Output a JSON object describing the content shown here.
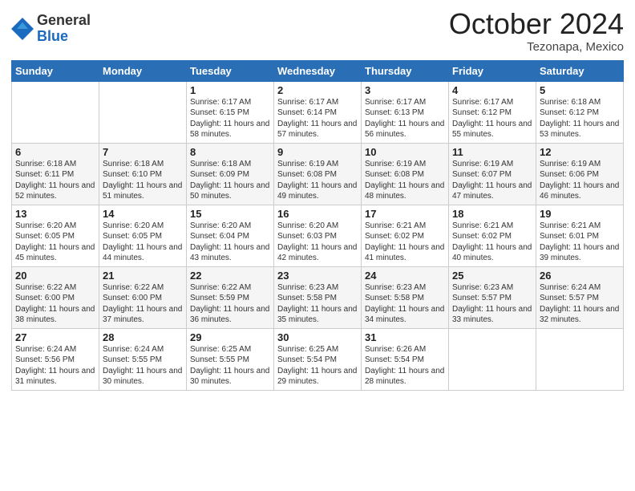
{
  "header": {
    "logo_general": "General",
    "logo_blue": "Blue",
    "month_title": "October 2024",
    "subtitle": "Tezonapa, Mexico"
  },
  "weekdays": [
    "Sunday",
    "Monday",
    "Tuesday",
    "Wednesday",
    "Thursday",
    "Friday",
    "Saturday"
  ],
  "weeks": [
    [
      {
        "day": "",
        "sunrise": "",
        "sunset": "",
        "daylight": ""
      },
      {
        "day": "",
        "sunrise": "",
        "sunset": "",
        "daylight": ""
      },
      {
        "day": "1",
        "sunrise": "Sunrise: 6:17 AM",
        "sunset": "Sunset: 6:15 PM",
        "daylight": "Daylight: 11 hours and 58 minutes."
      },
      {
        "day": "2",
        "sunrise": "Sunrise: 6:17 AM",
        "sunset": "Sunset: 6:14 PM",
        "daylight": "Daylight: 11 hours and 57 minutes."
      },
      {
        "day": "3",
        "sunrise": "Sunrise: 6:17 AM",
        "sunset": "Sunset: 6:13 PM",
        "daylight": "Daylight: 11 hours and 56 minutes."
      },
      {
        "day": "4",
        "sunrise": "Sunrise: 6:17 AM",
        "sunset": "Sunset: 6:12 PM",
        "daylight": "Daylight: 11 hours and 55 minutes."
      },
      {
        "day": "5",
        "sunrise": "Sunrise: 6:18 AM",
        "sunset": "Sunset: 6:12 PM",
        "daylight": "Daylight: 11 hours and 53 minutes."
      }
    ],
    [
      {
        "day": "6",
        "sunrise": "Sunrise: 6:18 AM",
        "sunset": "Sunset: 6:11 PM",
        "daylight": "Daylight: 11 hours and 52 minutes."
      },
      {
        "day": "7",
        "sunrise": "Sunrise: 6:18 AM",
        "sunset": "Sunset: 6:10 PM",
        "daylight": "Daylight: 11 hours and 51 minutes."
      },
      {
        "day": "8",
        "sunrise": "Sunrise: 6:18 AM",
        "sunset": "Sunset: 6:09 PM",
        "daylight": "Daylight: 11 hours and 50 minutes."
      },
      {
        "day": "9",
        "sunrise": "Sunrise: 6:19 AM",
        "sunset": "Sunset: 6:08 PM",
        "daylight": "Daylight: 11 hours and 49 minutes."
      },
      {
        "day": "10",
        "sunrise": "Sunrise: 6:19 AM",
        "sunset": "Sunset: 6:08 PM",
        "daylight": "Daylight: 11 hours and 48 minutes."
      },
      {
        "day": "11",
        "sunrise": "Sunrise: 6:19 AM",
        "sunset": "Sunset: 6:07 PM",
        "daylight": "Daylight: 11 hours and 47 minutes."
      },
      {
        "day": "12",
        "sunrise": "Sunrise: 6:19 AM",
        "sunset": "Sunset: 6:06 PM",
        "daylight": "Daylight: 11 hours and 46 minutes."
      }
    ],
    [
      {
        "day": "13",
        "sunrise": "Sunrise: 6:20 AM",
        "sunset": "Sunset: 6:05 PM",
        "daylight": "Daylight: 11 hours and 45 minutes."
      },
      {
        "day": "14",
        "sunrise": "Sunrise: 6:20 AM",
        "sunset": "Sunset: 6:05 PM",
        "daylight": "Daylight: 11 hours and 44 minutes."
      },
      {
        "day": "15",
        "sunrise": "Sunrise: 6:20 AM",
        "sunset": "Sunset: 6:04 PM",
        "daylight": "Daylight: 11 hours and 43 minutes."
      },
      {
        "day": "16",
        "sunrise": "Sunrise: 6:20 AM",
        "sunset": "Sunset: 6:03 PM",
        "daylight": "Daylight: 11 hours and 42 minutes."
      },
      {
        "day": "17",
        "sunrise": "Sunrise: 6:21 AM",
        "sunset": "Sunset: 6:02 PM",
        "daylight": "Daylight: 11 hours and 41 minutes."
      },
      {
        "day": "18",
        "sunrise": "Sunrise: 6:21 AM",
        "sunset": "Sunset: 6:02 PM",
        "daylight": "Daylight: 11 hours and 40 minutes."
      },
      {
        "day": "19",
        "sunrise": "Sunrise: 6:21 AM",
        "sunset": "Sunset: 6:01 PM",
        "daylight": "Daylight: 11 hours and 39 minutes."
      }
    ],
    [
      {
        "day": "20",
        "sunrise": "Sunrise: 6:22 AM",
        "sunset": "Sunset: 6:00 PM",
        "daylight": "Daylight: 11 hours and 38 minutes."
      },
      {
        "day": "21",
        "sunrise": "Sunrise: 6:22 AM",
        "sunset": "Sunset: 6:00 PM",
        "daylight": "Daylight: 11 hours and 37 minutes."
      },
      {
        "day": "22",
        "sunrise": "Sunrise: 6:22 AM",
        "sunset": "Sunset: 5:59 PM",
        "daylight": "Daylight: 11 hours and 36 minutes."
      },
      {
        "day": "23",
        "sunrise": "Sunrise: 6:23 AM",
        "sunset": "Sunset: 5:58 PM",
        "daylight": "Daylight: 11 hours and 35 minutes."
      },
      {
        "day": "24",
        "sunrise": "Sunrise: 6:23 AM",
        "sunset": "Sunset: 5:58 PM",
        "daylight": "Daylight: 11 hours and 34 minutes."
      },
      {
        "day": "25",
        "sunrise": "Sunrise: 6:23 AM",
        "sunset": "Sunset: 5:57 PM",
        "daylight": "Daylight: 11 hours and 33 minutes."
      },
      {
        "day": "26",
        "sunrise": "Sunrise: 6:24 AM",
        "sunset": "Sunset: 5:57 PM",
        "daylight": "Daylight: 11 hours and 32 minutes."
      }
    ],
    [
      {
        "day": "27",
        "sunrise": "Sunrise: 6:24 AM",
        "sunset": "Sunset: 5:56 PM",
        "daylight": "Daylight: 11 hours and 31 minutes."
      },
      {
        "day": "28",
        "sunrise": "Sunrise: 6:24 AM",
        "sunset": "Sunset: 5:55 PM",
        "daylight": "Daylight: 11 hours and 30 minutes."
      },
      {
        "day": "29",
        "sunrise": "Sunrise: 6:25 AM",
        "sunset": "Sunset: 5:55 PM",
        "daylight": "Daylight: 11 hours and 30 minutes."
      },
      {
        "day": "30",
        "sunrise": "Sunrise: 6:25 AM",
        "sunset": "Sunset: 5:54 PM",
        "daylight": "Daylight: 11 hours and 29 minutes."
      },
      {
        "day": "31",
        "sunrise": "Sunrise: 6:26 AM",
        "sunset": "Sunset: 5:54 PM",
        "daylight": "Daylight: 11 hours and 28 minutes."
      },
      {
        "day": "",
        "sunrise": "",
        "sunset": "",
        "daylight": ""
      },
      {
        "day": "",
        "sunrise": "",
        "sunset": "",
        "daylight": ""
      }
    ]
  ]
}
